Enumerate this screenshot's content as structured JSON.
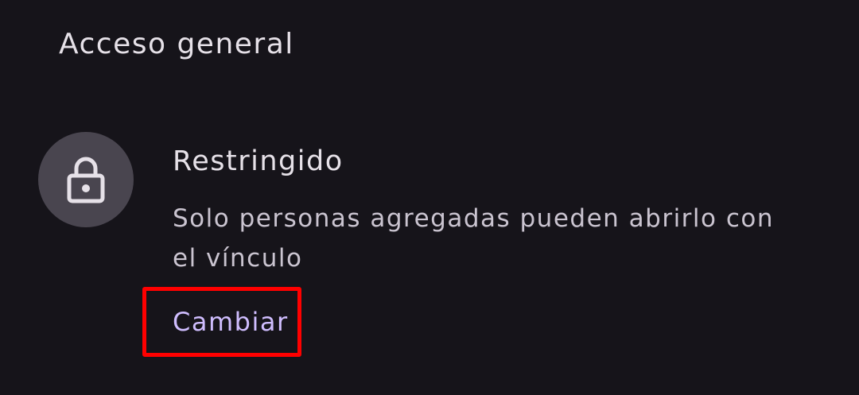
{
  "section": {
    "title": "Acceso general"
  },
  "access": {
    "icon": "lock-icon",
    "level": "Restringido",
    "description": "Solo personas agregadas pueden abrirlo con el vínculo",
    "change_label": "Cambiar"
  },
  "colors": {
    "background": "#16141a",
    "primary_text": "#e6e1e8",
    "secondary_text": "#cac4d0",
    "icon_circle": "#49454f",
    "accent": "#cfbdfe",
    "highlight": "#ff0000"
  }
}
